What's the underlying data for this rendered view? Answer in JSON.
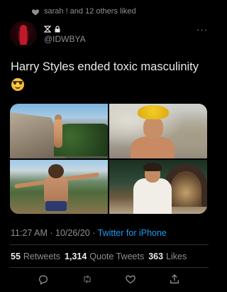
{
  "social_context": {
    "text": "sarah ! and 12 others liked",
    "icon": "heart-icon"
  },
  "author": {
    "name_icons": [
      "hourglass-icon",
      "lock-icon"
    ],
    "handle": "@IDWBYA",
    "more": "···"
  },
  "tweet": {
    "text": "Harry Styles ended toxic masculinity",
    "emoji": "star-struck-emoji",
    "photos": [
      {
        "name": "photo-cliff"
      },
      {
        "name": "photo-yellow-hat"
      },
      {
        "name": "photo-water"
      },
      {
        "name": "photo-archway"
      }
    ]
  },
  "meta": {
    "time": "11:27 AM",
    "separator": "·",
    "date": "10/26/20",
    "separator2": "·",
    "source": "Twitter for iPhone"
  },
  "stats": {
    "retweets_count": "55",
    "retweets_label": "Retweets",
    "quotes_count": "1,314",
    "quotes_label": "Quote Tweets",
    "likes_count": "363",
    "likes_label": "Likes"
  },
  "actions": [
    "reply-icon",
    "retweet-icon",
    "like-icon",
    "share-icon"
  ],
  "colors": {
    "background": "#000000",
    "text": "#e7e9ea",
    "muted": "#8b8f93",
    "link": "#1d9bf0"
  }
}
